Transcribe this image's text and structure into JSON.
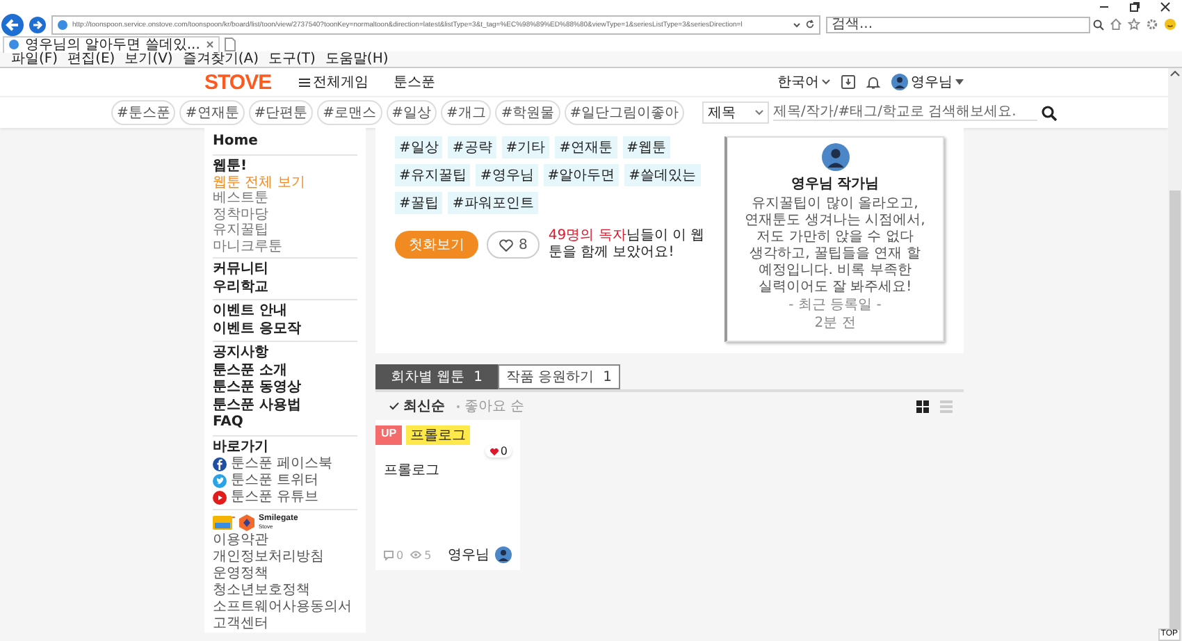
{
  "browser": {
    "url": "http://toonspoon.service.onstove.com/toonspoon/kr/board/list/toon/view/2737540?toonKey=normaltoon&direction=latest&listType=3&t_tag=%EC%98%89%ED%88%80&viewType=1&seriesListType=3&seriesDirection=l",
    "search_placeholder": "검색...",
    "tab_title": "영우님의 알아두면 쓸데있...",
    "menu": [
      "파일(F)",
      "편집(E)",
      "보기(V)",
      "즐겨찾기(A)",
      "도구(T)",
      "도움말(H)"
    ]
  },
  "header": {
    "logo": "STOVE",
    "nav": [
      {
        "label": "전체게임",
        "kind": "menu"
      },
      {
        "label": "툰스푼",
        "kind": "plain"
      }
    ],
    "language": "한국어",
    "user": "영우님"
  },
  "tag_bar": {
    "tags": [
      "#툰스푼",
      "#연재툰",
      "#단편툰",
      "#로맨스",
      "#일상",
      "#개그",
      "#학원물",
      "#일단그림이좋아"
    ],
    "select": "제목",
    "search_placeholder": "제목/작가/#태그/학교로 검색해보세요."
  },
  "sidebar": {
    "sections": [
      {
        "items": [
          {
            "label": "Home",
            "kind": "main"
          }
        ]
      },
      {
        "items": [
          {
            "label": "웹툰!",
            "kind": "heading"
          },
          {
            "label": "웹툰 전체 보기",
            "kind": "sub",
            "selected": true
          },
          {
            "label": "베스트툰",
            "kind": "sub",
            "selected": false
          },
          {
            "label": "정착마당",
            "kind": "sub",
            "selected": false
          },
          {
            "label": "유지꿀팁",
            "kind": "sub",
            "selected": false
          },
          {
            "label": "마니크루툰",
            "kind": "sub",
            "selected": false
          }
        ]
      },
      {
        "items": [
          {
            "label": "커뮤니티",
            "kind": "main"
          },
          {
            "label": "우리학교",
            "kind": "main"
          }
        ]
      },
      {
        "items": [
          {
            "label": "이벤트 안내",
            "kind": "main"
          },
          {
            "label": "이벤트 응모작",
            "kind": "main"
          }
        ]
      },
      {
        "items": [
          {
            "label": "공지사항",
            "kind": "main"
          },
          {
            "label": "툰스푼 소개",
            "kind": "main"
          },
          {
            "label": "툰스푼 동영상",
            "kind": "main"
          },
          {
            "label": "툰스푼 사용법",
            "kind": "main"
          },
          {
            "label": "FAQ",
            "kind": "main"
          }
        ]
      },
      {
        "items": [
          {
            "label": "바로가기",
            "kind": "heading"
          },
          {
            "label": "툰스푼 페이스북",
            "kind": "facebook"
          },
          {
            "label": "툰스푼 트위터",
            "kind": "twitter"
          },
          {
            "label": "툰스푼 유튜브",
            "kind": "youtube"
          }
        ]
      }
    ],
    "partner": {
      "name": "Smilegate",
      "sub": "Stove"
    },
    "footer_links": [
      "이용약관",
      "개인정보처리방침",
      "운영정책",
      "청소년보호정책",
      "소프트웨어사용동의서",
      "고객센터"
    ]
  },
  "series": {
    "tags": [
      "#일상",
      "#공략",
      "#기타",
      "#연재툰",
      "#웹툰",
      "#유지꿀팁",
      "#영우님",
      "#알아두면",
      "#쓸데있는",
      "#꿀팁",
      "#파워포인트"
    ],
    "first_button": "첫화보기",
    "likes": "8",
    "readers": "**49명의 독자**님들이 이 웹툰을 함께 보았어요!"
  },
  "author_card": {
    "name": "영우님 작가님",
    "bio": "유지꿀팁이 많이 올라오고, 연재툰도 생겨나는 시점에서, 저도 가만히 앉을 수 없다 생각하고, 꿀팁들을 연재 할 예정입니다. 비록 부족한 실력이어도 잘 봐주세요!",
    "date_label": "- 최근 등록일 -",
    "date": "2분 전"
  },
  "tabs": [
    {
      "label": "회차별 웹툰",
      "count": "1",
      "selected": true
    },
    {
      "label": "작품 응원하기",
      "count": "1",
      "selected": false
    }
  ],
  "sort": [
    {
      "label": "최신순",
      "selected": true
    },
    {
      "label": "좋아요 순",
      "selected": false
    }
  ],
  "view_modes": [
    {
      "kind": "grid",
      "selected": true
    },
    {
      "kind": "list",
      "selected": false
    }
  ],
  "episodes": [
    {
      "badge": "UP",
      "tag": "프롤로그",
      "likes": "0",
      "title": "프롤로그",
      "comments": "0",
      "views": "5",
      "author": "영우님"
    }
  ],
  "top_button": "TOP"
}
